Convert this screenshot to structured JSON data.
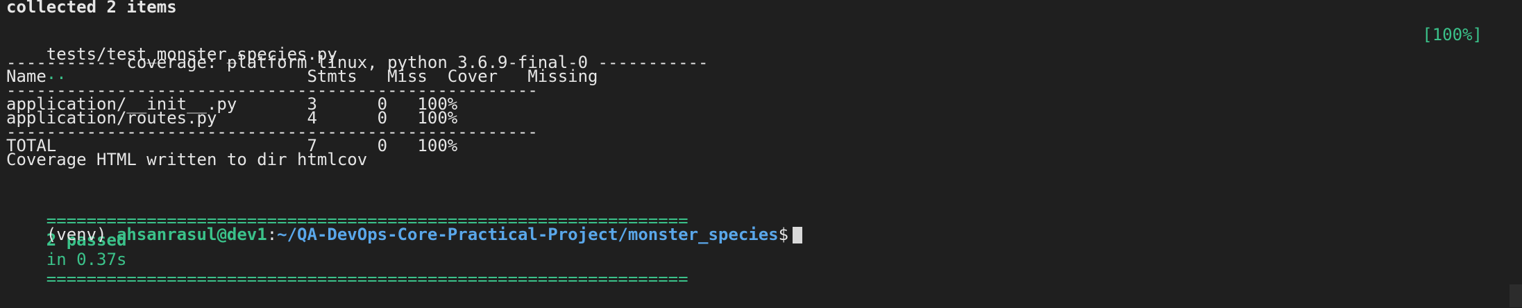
{
  "terminal": {
    "collected": "collected 2 items",
    "test_file": "tests/test_monster_species.py",
    "test_dots": "..",
    "progress_percent": "[100%]",
    "coverage_header": "----------- coverage: platform linux, python 3.6.9-final-0 -----------",
    "table_header": "Name                          Stmts   Miss  Cover   Missing",
    "separator": "-----------------------------------------------------",
    "rows": [
      {
        "text": "application/__init__.py       3      0   100%"
      },
      {
        "text": "application/routes.py         4      0   100%"
      }
    ],
    "total": "TOTAL                         7      0   100%",
    "html_written": "Coverage HTML written to dir htmlcov",
    "summary_left_rule": "================================================================",
    "summary_passed": "2 passed",
    "summary_time": "in 0.37s",
    "summary_right_rule": "================================================================",
    "prompt_venv": "(venv) ",
    "prompt_user": "ahsanrasul@dev1",
    "prompt_colon": ":",
    "prompt_path": "~/QA-DevOps-Core-Practical-Project/monster_species",
    "prompt_symbol": "$"
  },
  "colors": {
    "background": "#1f1f1f",
    "text": "#e6e6e6",
    "success_green": "#3bc28a",
    "prompt_blue": "#5aa7ea"
  }
}
